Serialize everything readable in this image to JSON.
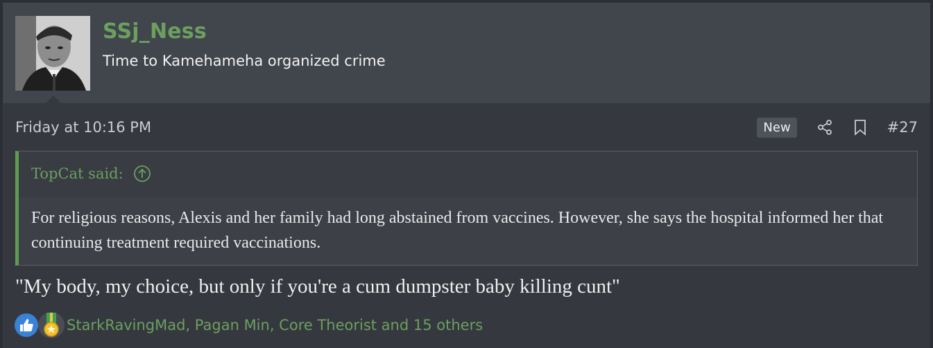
{
  "user": {
    "name": "SSj_Ness",
    "title": "Time to Kamehameha organized crime"
  },
  "post": {
    "date": "Friday at 10:16 PM",
    "new_badge": "New",
    "number": "#27"
  },
  "quote": {
    "author": "TopCat said:",
    "text": "For religious reasons, Alexis and her family had long abstained from vaccines. However, she says the hospital informed her that continuing treatment required vaccinations."
  },
  "message": "\"My body, my choice, but only if you're a cum dumpster baby killing cunt\"",
  "reactions": {
    "icons": [
      "like-icon",
      "medal-icon"
    ],
    "summary": "StarkRavingMad, Pagan Min, Core Theorist and 15 others"
  },
  "colors": {
    "accent_green": "#6ba05f",
    "background": "#35383f",
    "header": "#41454c"
  }
}
